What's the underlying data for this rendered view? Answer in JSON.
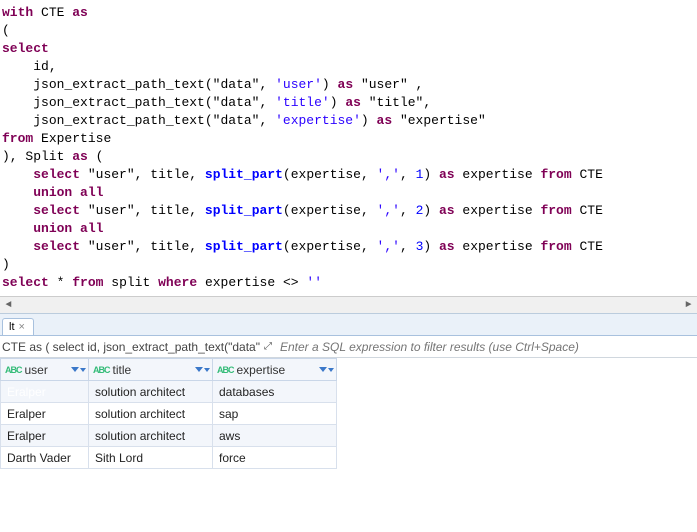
{
  "sql": {
    "kw_with": "with",
    "cte_name": "CTE",
    "kw_as": "as",
    "paren_open": "(",
    "kw_select": "select",
    "col_id": "id,",
    "fn": "json_extract_path_text",
    "dq_data": "\"data\"",
    "comma": ",",
    "sq_user": "'user'",
    "sq_title": "'title'",
    "sq_expertise": "'expertise'",
    "paren_close": ")",
    "dq_user": "\"user\"",
    "dq_title": "\"title\"",
    "dq_expertise": "\"expertise\"",
    "kw_from": "from",
    "tbl_expertise": "Expertise",
    "split_name": "Split",
    "title_col": "title",
    "split_fn": "split_part",
    "exp_col": "expertise",
    "sq_comma": "','",
    "n1": "1",
    "n2": "2",
    "n3": "3",
    "kw_union": "union all",
    "final_select": "select",
    "star": "*",
    "from2": "from",
    "split_lc": "split",
    "kw_where": "where",
    "neq": "<>",
    "empty": "''",
    "trailing_comma": " ,"
  },
  "tab": {
    "label": "lt"
  },
  "cte_summary": "CTE as ( select id, json_extract_path_text(\"data\"",
  "filter_placeholder": "Enter a SQL expression to filter results (use Ctrl+Space)",
  "columns": [
    {
      "name": "user"
    },
    {
      "name": "title"
    },
    {
      "name": "expertise"
    }
  ],
  "rows": [
    {
      "user": "Eralper",
      "title": "solution architect",
      "expertise": "databases",
      "selected": true,
      "alt": true
    },
    {
      "user": "Eralper",
      "title": "solution architect",
      "expertise": "sap",
      "selected": false,
      "alt": false
    },
    {
      "user": "Eralper",
      "title": "solution architect",
      "expertise": "aws",
      "selected": false,
      "alt": true
    },
    {
      "user": "Darth Vader",
      "title": "Sith Lord",
      "expertise": "force",
      "selected": false,
      "alt": false
    }
  ],
  "chart_data": {
    "type": "table",
    "columns": [
      "user",
      "title",
      "expertise"
    ],
    "rows": [
      [
        "Eralper",
        "solution architect",
        "databases"
      ],
      [
        "Eralper",
        "solution architect",
        "sap"
      ],
      [
        "Eralper",
        "solution architect",
        "aws"
      ],
      [
        "Darth Vader",
        "Sith Lord",
        "force"
      ]
    ]
  }
}
